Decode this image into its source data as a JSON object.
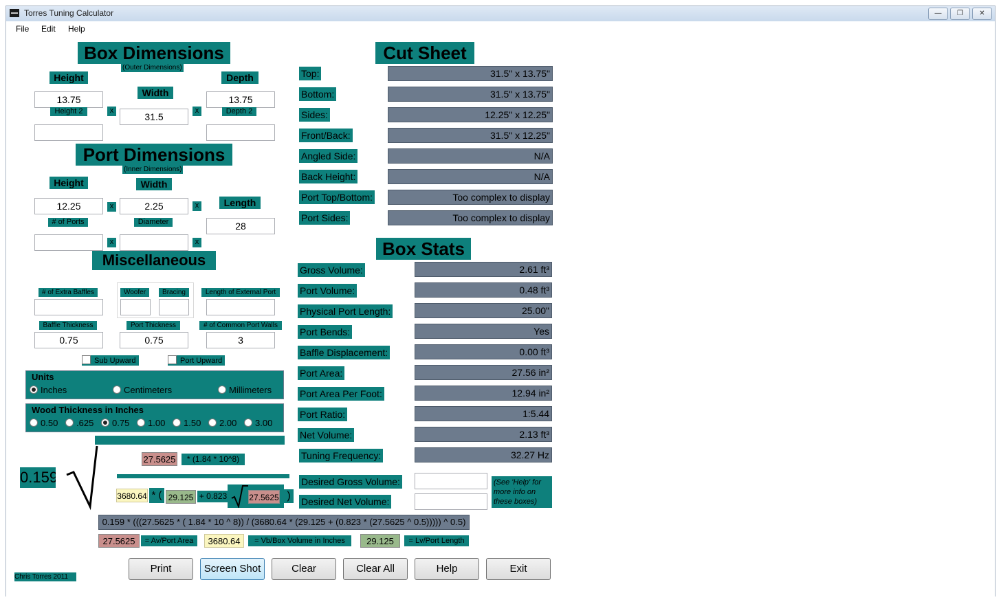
{
  "window": {
    "title": "Torres Tuning Calculator"
  },
  "menu": [
    "File",
    "Edit",
    "Help"
  ],
  "box_dimensions": {
    "title": "Box Dimensions",
    "subtitle": "(Outer Dimensions)",
    "height_label": "Height",
    "height_value": "13.75",
    "width_label": "Width",
    "width_value": "31.5",
    "depth_label": "Depth",
    "depth_value": "13.75",
    "height2_label": "Height 2",
    "height2_value": "",
    "depth2_label": "Depth 2",
    "depth2_value": "",
    "x": "x"
  },
  "port_dimensions": {
    "title": "Port Dimensions",
    "subtitle": "(Inner Dimensions)",
    "height_label": "Height",
    "height_value": "12.25",
    "width_label": "Width",
    "width_value": "2.25",
    "length_label": "Length",
    "length_value": "28",
    "ports_label": "# of Ports",
    "ports_value": "",
    "diameter_label": "Diameter",
    "diameter_value": ""
  },
  "misc": {
    "title": "Miscellaneous",
    "extra_baffles_label": "# of Extra Baffles",
    "extra_baffles_value": "",
    "woofer_label": "Woofer",
    "woofer_value": "",
    "bracing_label": "Bracing",
    "bracing_value": "",
    "ext_port_label": "Length of External Port",
    "ext_port_value": "",
    "baffle_thick_label": "Baffle Thickness",
    "baffle_thick_value": "0.75",
    "port_thick_label": "Port Thickness",
    "port_thick_value": "0.75",
    "common_walls_label": "# of Common Port Walls",
    "common_walls_value": "3",
    "sub_upward": "Sub Upward",
    "port_upward": "Port Upward"
  },
  "units": {
    "title": "Units",
    "options": [
      "Inches",
      "Centimeters",
      "Millimeters"
    ],
    "selected": "Inches"
  },
  "wood": {
    "title": "Wood Thickness in Inches",
    "options": [
      "0.50",
      ".625",
      "0.75",
      "1.00",
      "1.50",
      "2.00",
      "3.00"
    ],
    "selected": "0.75"
  },
  "cut_sheet": {
    "title": "Cut Sheet",
    "rows": [
      {
        "label": "Top:",
        "value": "31.5\" x 13.75\""
      },
      {
        "label": "Bottom:",
        "value": "31.5\" x 13.75\""
      },
      {
        "label": "Sides:",
        "value": "12.25\" x 12.25\""
      },
      {
        "label": "Front/Back:",
        "value": "31.5\" x 12.25\""
      },
      {
        "label": "Angled Side:",
        "value": "N/A"
      },
      {
        "label": "Back Height:",
        "value": "N/A"
      },
      {
        "label": "Port Top/Bottom:",
        "value": "Too complex to display"
      },
      {
        "label": "Port Sides:",
        "value": "Too complex to display"
      }
    ]
  },
  "box_stats": {
    "title": "Box Stats",
    "rows": [
      {
        "label": "Gross Volume:",
        "value": "2.61 ft³"
      },
      {
        "label": "Port Volume:",
        "value": "0.48 ft³"
      },
      {
        "label": "Physical Port Length:",
        "value": "25.00\""
      },
      {
        "label": "Port Bends:",
        "value": "Yes"
      },
      {
        "label": "Baffle Displacement:",
        "value": "0.00 ft³"
      },
      {
        "label": "Port Area:",
        "value": "27.56 in²"
      },
      {
        "label": "Port Area Per Foot:",
        "value": "12.94 in²"
      },
      {
        "label": "Port Ratio:",
        "value": "1:5.44"
      },
      {
        "label": "Net Volume:",
        "value": "2.13 ft³"
      },
      {
        "label": "Tuning Frequency:",
        "value": "32.27 Hz"
      }
    ],
    "desired_gross_label": "Desired Gross Volume:",
    "desired_gross_value": "",
    "desired_net_label": "Desired Net Volume:",
    "desired_net_value": "",
    "help_note": "(See 'Help' for more info on these boxes)"
  },
  "formula": {
    "coef": "0.159",
    "av": "27.5625",
    "mult": "* (1.84 * 10^8)",
    "vb": "3680.64",
    "star_paren": "* (",
    "lv": "29.125",
    "plus": "+ 0.823",
    "close": ")",
    "full": "0.159 * (((27.5625 * ( 1.84 * 10 ^ 8)) / (3680.64 * (29.125 + (0.823 * (27.5625 ^ 0.5))))) ^ 0.5)",
    "legend_av": "= Av/Port Area",
    "legend_vb": "= Vb/Box Volume in Inches",
    "legend_lv": "= Lv/Port Length"
  },
  "buttons": {
    "print": "Print",
    "screenshot": "Screen Shot",
    "clear": "Clear",
    "clear_all": "Clear All",
    "help": "Help",
    "exit": "Exit"
  },
  "credit": "Chris Torres 2011"
}
